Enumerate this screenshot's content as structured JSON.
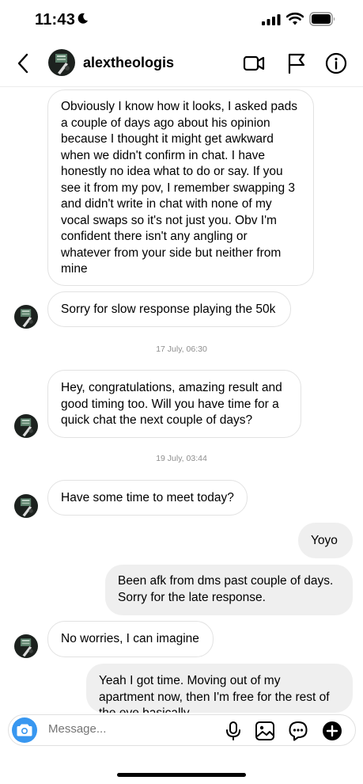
{
  "status_bar": {
    "time": "11:43",
    "icons": [
      "moon-icon",
      "cellular-signal-icon",
      "wifi-icon",
      "battery-icon"
    ]
  },
  "header": {
    "username": "alextheologis",
    "icons": [
      "back-chevron-icon",
      "video-call-icon",
      "flag-icon",
      "info-icon"
    ]
  },
  "messages": {
    "m1": {
      "sender": "them",
      "lines": [
        "Obviously I know how it looks, I asked pads",
        "a couple of days ago about his opinion",
        "because I thought it might get awkward",
        "when we didn't confirm in chat. I have",
        "honestly no idea what to do or say. If you",
        "see it from my pov, I remember swapping 3",
        "and didn't write in chat with none of my",
        "vocal swaps so it's not just you. Obv I'm",
        "confident there isn't any angling or",
        "whatever from your side but neither from",
        "mine"
      ]
    },
    "m2": {
      "sender": "them",
      "text": "Sorry for slow response playing the 50k"
    },
    "stamp1": "17 July, 06:30",
    "m3": {
      "sender": "them",
      "lines": [
        "Hey, congratulations, amazing result and",
        "good timing too. Will you have time for a",
        "quick chat the next couple of days?"
      ]
    },
    "stamp2": "19 July, 03:44",
    "m4": {
      "sender": "them",
      "text": "Have some time to meet today?"
    },
    "m5": {
      "sender": "me",
      "text": "Yoyo"
    },
    "m6": {
      "sender": "me",
      "lines": [
        "Been afk from dms past couple of days.",
        "Sorry for the late response."
      ]
    },
    "m7": {
      "sender": "them",
      "text": "No worries, I can imagine"
    },
    "m8": {
      "sender": "me",
      "lines": [
        "Yeah I got time. Moving out of my",
        "apartment now, then I'm free for the rest of",
        "the eve basically"
      ]
    }
  },
  "composer": {
    "placeholder": "Message...",
    "icons": [
      "camera-icon",
      "microphone-icon",
      "gallery-icon",
      "sticker-icon",
      "plus-icon"
    ]
  },
  "colors": {
    "accent": "#3897f0",
    "incoming_border": "#e2e2e2",
    "outgoing_bg": "#efefef",
    "timestamp": "#8e8e8e"
  }
}
